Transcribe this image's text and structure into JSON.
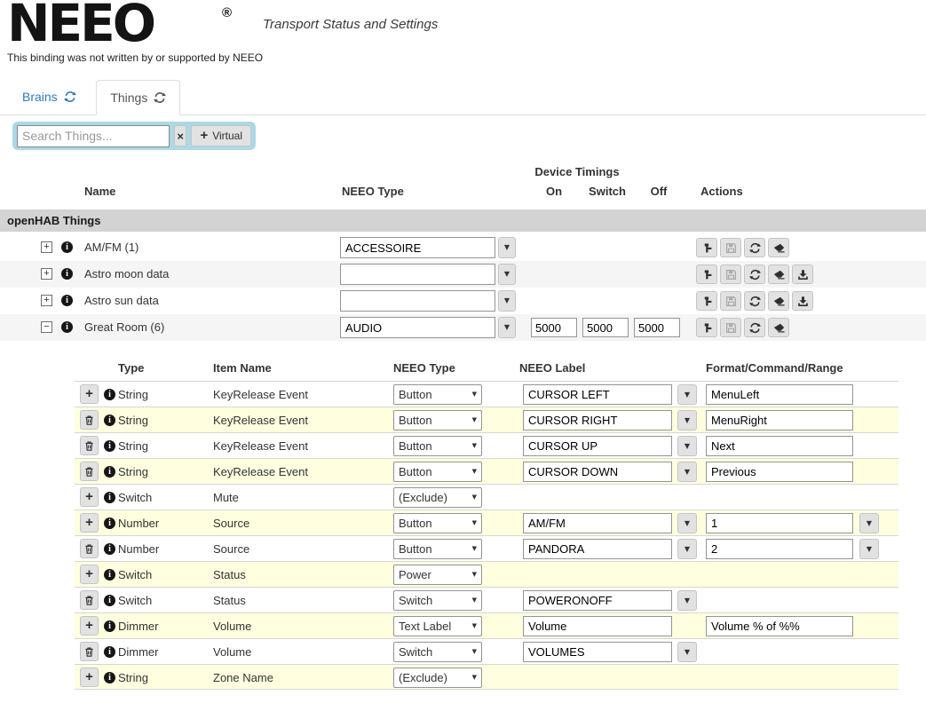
{
  "header": {
    "logo": "NEEO",
    "registered": "®",
    "subtitle": "Transport Status and Settings",
    "disclaimer": "This binding was not written by or supported by NEEO"
  },
  "tabs": [
    {
      "label": "Brains",
      "icon": "refresh-icon",
      "active": false
    },
    {
      "label": "Things",
      "icon": "refresh-icon",
      "active": true
    }
  ],
  "toolbar": {
    "search_placeholder": "Search Things...",
    "clear_icon": "x-icon",
    "virtual_label": "Virtual",
    "virtual_icon": "plus-icon"
  },
  "things_table": {
    "group_header": "Device Timings",
    "columns": {
      "name": "Name",
      "neeo_type": "NEEO Type",
      "on": "On",
      "switch": "Switch",
      "off": "Off",
      "actions": "Actions"
    },
    "section_header": "openHAB Things",
    "action_icons": [
      "hammer-icon",
      "save-icon",
      "refresh-icon",
      "eraser-icon",
      "download-icon"
    ],
    "rows": [
      {
        "expander": "+",
        "name": "AM/FM (1)",
        "neeo_type": "ACCESSOIRE",
        "download": false
      },
      {
        "expander": "+",
        "name": "Astro moon data",
        "neeo_type": "",
        "download": true
      },
      {
        "expander": "+",
        "name": "Astro sun data",
        "neeo_type": "",
        "download": true
      },
      {
        "expander": "−",
        "name": "Great Room (6)",
        "neeo_type": "AUDIO",
        "download": false,
        "timings": {
          "on": "5000",
          "switch": "5000",
          "off": "5000"
        }
      }
    ]
  },
  "channel_table": {
    "columns": {
      "type": "Type",
      "item_name": "Item Name",
      "neeo_type": "NEEO Type",
      "neeo_label": "NEEO Label",
      "format": "Format/Command/Range"
    },
    "rows": [
      {
        "action": "add",
        "type": "String",
        "item": "KeyRelease Event",
        "neeo_type": "Button",
        "label": "CURSOR LEFT",
        "format": "MenuLeft"
      },
      {
        "action": "delete",
        "type": "String",
        "item": "KeyRelease Event",
        "neeo_type": "Button",
        "label": "CURSOR RIGHT",
        "format": "MenuRight"
      },
      {
        "action": "delete",
        "type": "String",
        "item": "KeyRelease Event",
        "neeo_type": "Button",
        "label": "CURSOR UP",
        "format": "Next"
      },
      {
        "action": "delete",
        "type": "String",
        "item": "KeyRelease Event",
        "neeo_type": "Button",
        "label": "CURSOR DOWN",
        "format": "Previous"
      },
      {
        "action": "add",
        "type": "Switch",
        "item": "Mute",
        "neeo_type": "(Exclude)"
      },
      {
        "action": "add",
        "type": "Number",
        "item": "Source",
        "neeo_type": "Button",
        "label": "AM/FM",
        "format": "1"
      },
      {
        "action": "delete",
        "type": "Number",
        "item": "Source",
        "neeo_type": "Button",
        "label": "PANDORA",
        "format": "2"
      },
      {
        "action": "add",
        "type": "Switch",
        "item": "Status",
        "neeo_type": "Power"
      },
      {
        "action": "delete",
        "type": "Switch",
        "item": "Status",
        "neeo_type": "Switch",
        "label": "POWERONOFF"
      },
      {
        "action": "add",
        "type": "Dimmer",
        "item": "Volume",
        "neeo_type": "Text Label",
        "label": "Volume",
        "format": "Volume % of %%"
      },
      {
        "action": "delete",
        "type": "Dimmer",
        "item": "Volume",
        "neeo_type": "Switch",
        "label": "VOLUMES"
      },
      {
        "action": "add",
        "type": "String",
        "item": "Zone Name",
        "neeo_type": "(Exclude)"
      }
    ]
  },
  "colors": {
    "panel_blue": "#add8e6",
    "row_yellow": "#ffffe0",
    "section_gray": "#d3d3d3",
    "link_blue": "#337ab7",
    "button_gray": "#e2e2e2"
  }
}
